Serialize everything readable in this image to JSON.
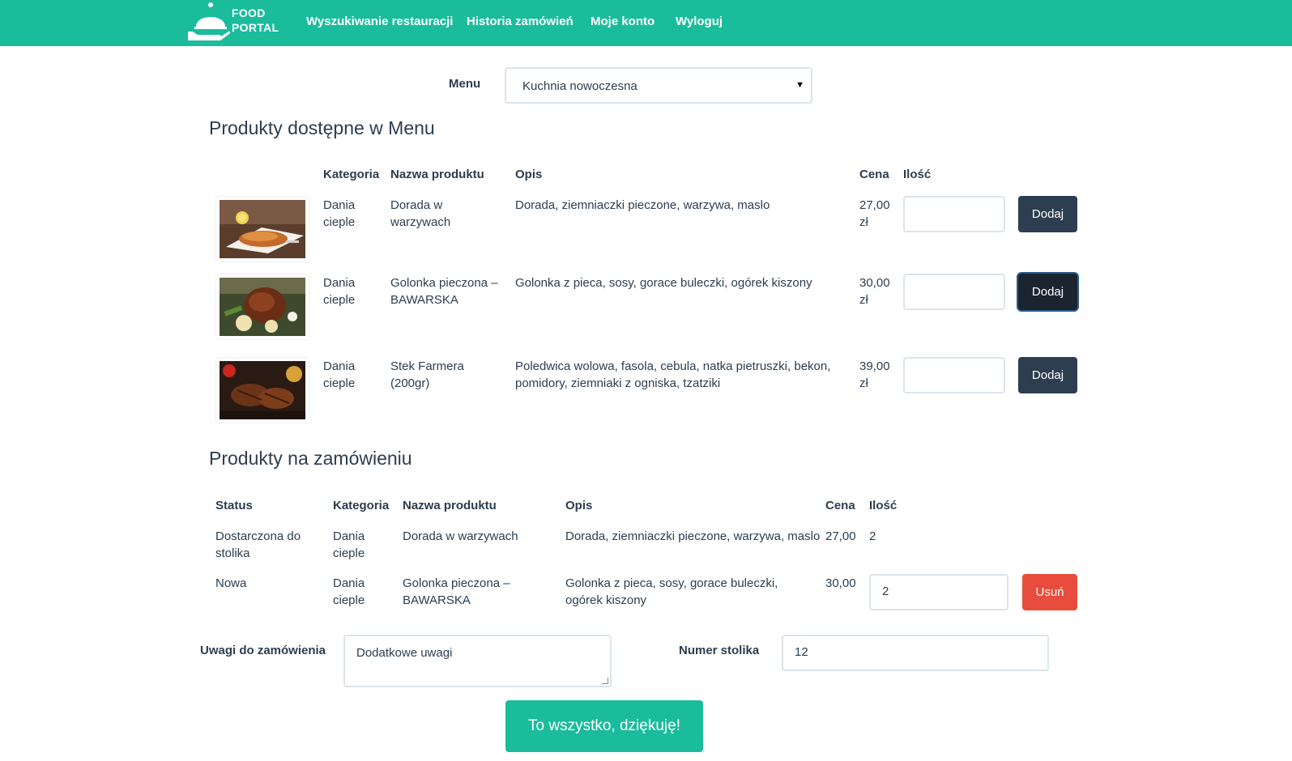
{
  "nav": {
    "logo_line1": "FOOD",
    "logo_line2": "PORTAL",
    "links": [
      "Wyszukiwanie restauracji",
      "Historia zamówień",
      "Moje konto",
      "Wyloguj"
    ]
  },
  "menu": {
    "label": "Menu",
    "selected": "Kuchnia nowoczesna"
  },
  "available": {
    "heading": "Produkty dostępne w Menu",
    "headers": {
      "category": "Kategoria",
      "name": "Nazwa produktu",
      "desc": "Opis",
      "price": "Cena",
      "qty": "Ilość"
    },
    "add_label": "Dodaj",
    "rows": [
      {
        "category": "Dania cieple",
        "name": "Dorada w warzywach",
        "desc": "Dorada, ziemniaczki pieczone, warzywa, maslo",
        "price": "27,00 zł",
        "image": "fish-dish-photo"
      },
      {
        "category": "Dania cieple",
        "name": "Golonka pieczona – BAWARSKA",
        "desc": "Golonka z pieca, sosy, gorace buleczki, ogórek kiszony",
        "price": "30,00 zł",
        "image": "pork-knuckle-photo"
      },
      {
        "category": "Dania cieple",
        "name": "Stek Farmera (200gr)",
        "desc": "Poledwica wolowa, fasola, cebula, natka pietruszki, bekon, pomidory, ziemniaki z ogniska, tzatziki",
        "price": "39,00 zł",
        "image": "steak-photo"
      }
    ]
  },
  "order": {
    "heading": "Produkty na zamówieniu",
    "headers": {
      "status": "Status",
      "category": "Kategoria",
      "name": "Nazwa produktu",
      "desc": "Opis",
      "price": "Cena",
      "qty": "Ilość"
    },
    "remove_label": "Usuń",
    "rows": [
      {
        "status": "Dostarczona do stolika",
        "category": "Dania cieple",
        "name": "Dorada w warzywach",
        "desc": "Dorada, ziemniaczki pieczone, warzywa, maslo",
        "price": "27,00",
        "qty": "2"
      },
      {
        "status": "Nowa",
        "category": "Dania cieple",
        "name": "Golonka pieczona – BAWARSKA",
        "desc": "Golonka z pieca, sosy, gorace buleczki, ogórek kiszony",
        "price": "30,00",
        "qty": "2"
      }
    ]
  },
  "form": {
    "notes_label": "Uwagi do zamówienia",
    "notes_value": "Dodatkowe uwagi",
    "table_label": "Numer stolika",
    "table_value": "12",
    "submit_label": "To wszystko, dziękuję!"
  },
  "colors": {
    "primary": "#1abc9c",
    "dark": "#2c3e50",
    "danger": "#e74c3c"
  }
}
